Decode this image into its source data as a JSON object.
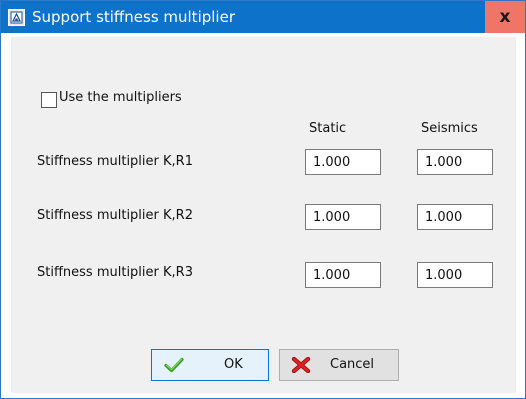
{
  "window": {
    "title": "Support stiffness multiplier",
    "close_glyph": "x",
    "app_icon": "app-icon",
    "title_bar_color": "#0d72c9",
    "close_button_color": "#ee7568"
  },
  "options": {
    "use_multipliers_label": "Use the multipliers",
    "use_multipliers_checked": false
  },
  "columns": {
    "static": "Static",
    "seismics": "Seismics"
  },
  "rows": [
    {
      "label": "Stiffness multiplier K,R1",
      "static": "1.000",
      "seismics": "1.000"
    },
    {
      "label": "Stiffness multiplier K,R2",
      "static": "1.000",
      "seismics": "1.000"
    },
    {
      "label": "Stiffness multiplier K,R3",
      "static": "1.000",
      "seismics": "1.000"
    }
  ],
  "buttons": {
    "ok_label": "OK",
    "ok_icon": "checkmark-icon",
    "cancel_label": "Cancel",
    "cancel_icon": "red-x-icon"
  }
}
